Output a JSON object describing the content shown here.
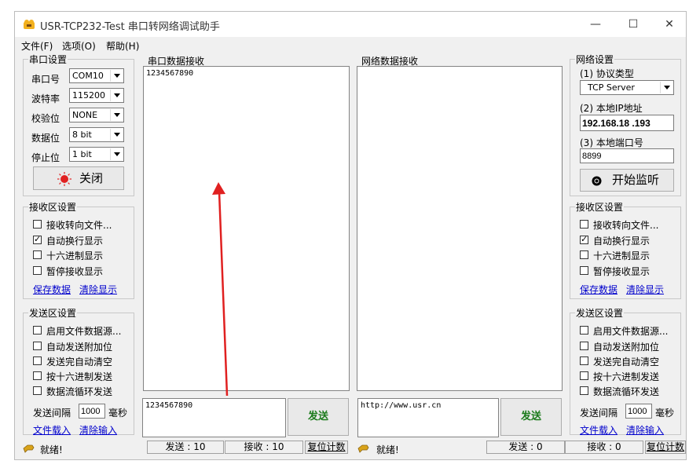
{
  "window": {
    "title": "USR-TCP232-Test 串口转网络调试助手",
    "minimize": "—",
    "maximize": "☐",
    "close": "✕"
  },
  "menu": [
    "文件(F)",
    "选项(O)",
    "帮助(H)"
  ],
  "serial_settings": {
    "title": "串口设置",
    "port_label": "串口号",
    "port_value": "COM10",
    "baud_label": "波特率",
    "baud_value": "115200",
    "parity_label": "校验位",
    "parity_value": "NONE",
    "databits_label": "数据位",
    "databits_value": "8 bit",
    "stopbits_label": "停止位",
    "stopbits_value": "1 bit",
    "close_button": "关闭"
  },
  "left_receive": {
    "title": "接收区设置",
    "options": [
      {
        "label": "接收转向文件...",
        "checked": false
      },
      {
        "label": "自动换行显示",
        "checked": true
      },
      {
        "label": "十六进制显示",
        "checked": false
      },
      {
        "label": "暂停接收显示",
        "checked": false
      }
    ],
    "save_link": "保存数据",
    "clear_link": "清除显示"
  },
  "left_send": {
    "title": "发送区设置",
    "options": [
      {
        "label": "启用文件数据源...",
        "checked": false
      },
      {
        "label": "自动发送附加位",
        "checked": false
      },
      {
        "label": "发送完自动清空",
        "checked": false
      },
      {
        "label": "按十六进制发送",
        "checked": false
      },
      {
        "label": "数据流循环发送",
        "checked": false
      }
    ],
    "interval_label": "发送间隔",
    "interval_value": "1000",
    "interval_unit": "毫秒",
    "load_link": "文件载入",
    "clear_link": "清除输入"
  },
  "serial_receive": {
    "title": "串口数据接收",
    "content": "1234567890"
  },
  "network_receive": {
    "title": "网络数据接收",
    "content": ""
  },
  "serial_send": {
    "content": "1234567890",
    "send_button": "发送"
  },
  "network_send": {
    "content": "http://www.usr.cn",
    "send_button": "发送"
  },
  "network_settings": {
    "title": "网络设置",
    "protocol_label": "(1) 协议类型",
    "protocol_value": "TCP Server",
    "ip_label": "(2) 本地IP地址",
    "ip_value": "192.168.18 .193",
    "port_label": "(3) 本地端口号",
    "port_value": "8899",
    "listen_button": "开始监听"
  },
  "right_receive": {
    "title": "接收区设置",
    "options": [
      {
        "label": "接收转向文件...",
        "checked": false
      },
      {
        "label": "自动换行显示",
        "checked": true
      },
      {
        "label": "十六进制显示",
        "checked": false
      },
      {
        "label": "暂停接收显示",
        "checked": false
      }
    ],
    "save_link": "保存数据",
    "clear_link": "清除显示"
  },
  "right_send": {
    "title": "发送区设置",
    "options": [
      {
        "label": "启用文件数据源...",
        "checked": false
      },
      {
        "label": "自动发送附加位",
        "checked": false
      },
      {
        "label": "发送完自动清空",
        "checked": false
      },
      {
        "label": "按十六进制发送",
        "checked": false
      },
      {
        "label": "数据流循环发送",
        "checked": false
      }
    ],
    "interval_label": "发送间隔",
    "interval_value": "1000",
    "interval_unit": "毫秒",
    "load_link": "文件载入",
    "clear_link": "清除输入"
  },
  "status_left": {
    "ready": "就绪!",
    "sent": "发送 : 10",
    "received": "接收 : 10",
    "reset": "复位计数"
  },
  "status_right": {
    "ready": "就绪!",
    "sent": "发送 : 0",
    "received": "接收 : 0",
    "reset": "复位计数"
  },
  "colors": {
    "accent_red": "#e02020",
    "send_text": "#1a7a1a",
    "link": "#0000cc"
  }
}
